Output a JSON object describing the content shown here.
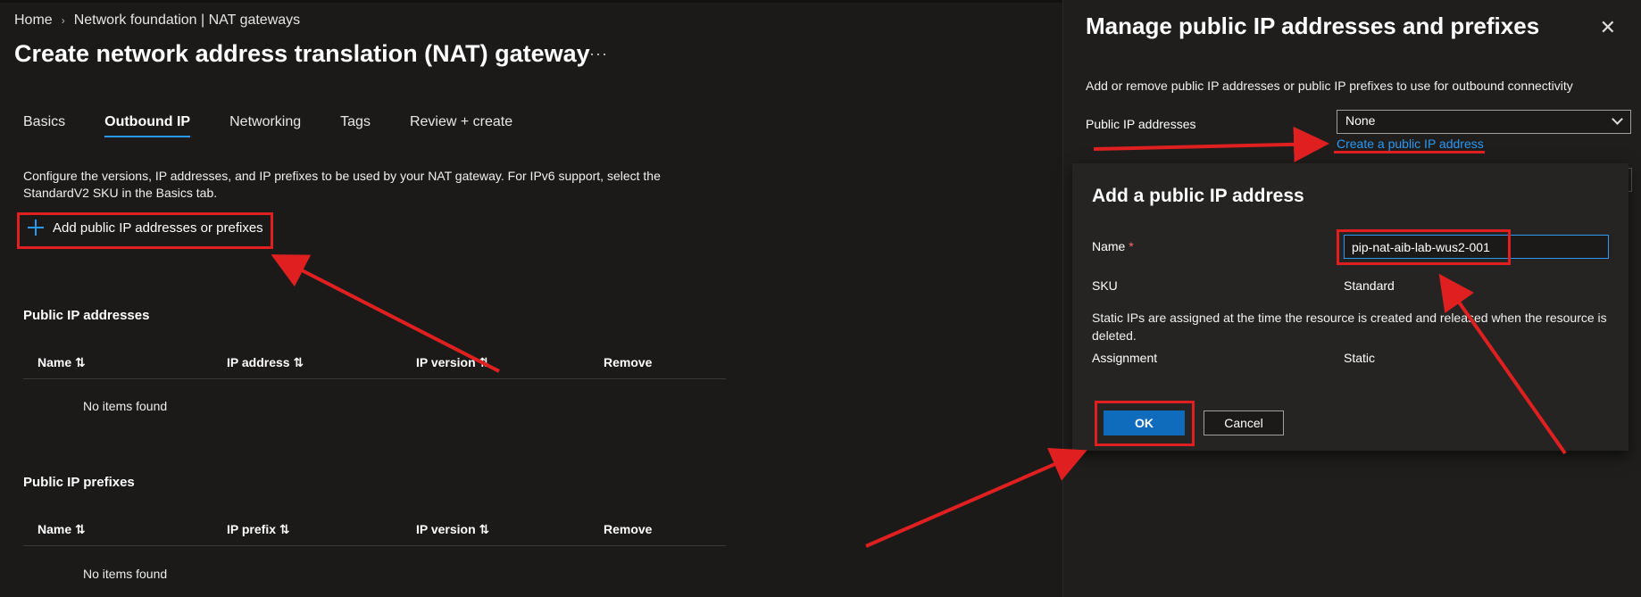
{
  "breadcrumb": {
    "home": "Home",
    "separator": "›",
    "parent": "Network foundation | NAT gateways"
  },
  "page": {
    "title": "Create network address translation (NAT) gateway",
    "more": "···"
  },
  "tabs": [
    {
      "label": "Basics",
      "active": false
    },
    {
      "label": "Outbound IP",
      "active": true
    },
    {
      "label": "Networking",
      "active": false
    },
    {
      "label": "Tags",
      "active": false
    },
    {
      "label": "Review + create",
      "active": false
    }
  ],
  "description": "Configure the versions, IP addresses, and IP prefixes to be used by your NAT gateway. For IPv6 support, select the StandardV2 SKU in the Basics tab.",
  "add_button": {
    "label": "Add public IP addresses or prefixes",
    "icon": "plus-icon"
  },
  "public_ip_addresses": {
    "title": "Public IP addresses",
    "columns": [
      "Name ⇅",
      "IP address ⇅",
      "IP version ⇅",
      "Remove"
    ],
    "empty": "No items found"
  },
  "public_ip_prefixes": {
    "title": "Public IP prefixes",
    "columns": [
      "Name ⇅",
      "IP prefix ⇅",
      "IP version ⇅",
      "Remove"
    ],
    "empty": "No items found"
  },
  "panel": {
    "title": "Manage public IP addresses and prefixes",
    "close": "✕",
    "description": "Add or remove public IP addresses or public IP prefixes to use for outbound connectivity",
    "pip_label": "Public IP addresses",
    "pip_selected": "None",
    "create_link": "Create a public IP address"
  },
  "dialog": {
    "title": "Add a public IP address",
    "name_label": "Name",
    "required_mark": "*",
    "name_value": "pip-nat-aib-lab-wus2-001",
    "sku_label": "SKU",
    "sku_value": "Standard",
    "note": "Static IPs are assigned at the time the resource is created and released when the resource is deleted.",
    "assignment_label": "Assignment",
    "assignment_value": "Static",
    "ok": "OK",
    "cancel": "Cancel"
  },
  "colors": {
    "background": "#1b1a19",
    "accent": "#2899f5",
    "primary_button": "#0f6cbd",
    "annotation": "#e02020"
  }
}
